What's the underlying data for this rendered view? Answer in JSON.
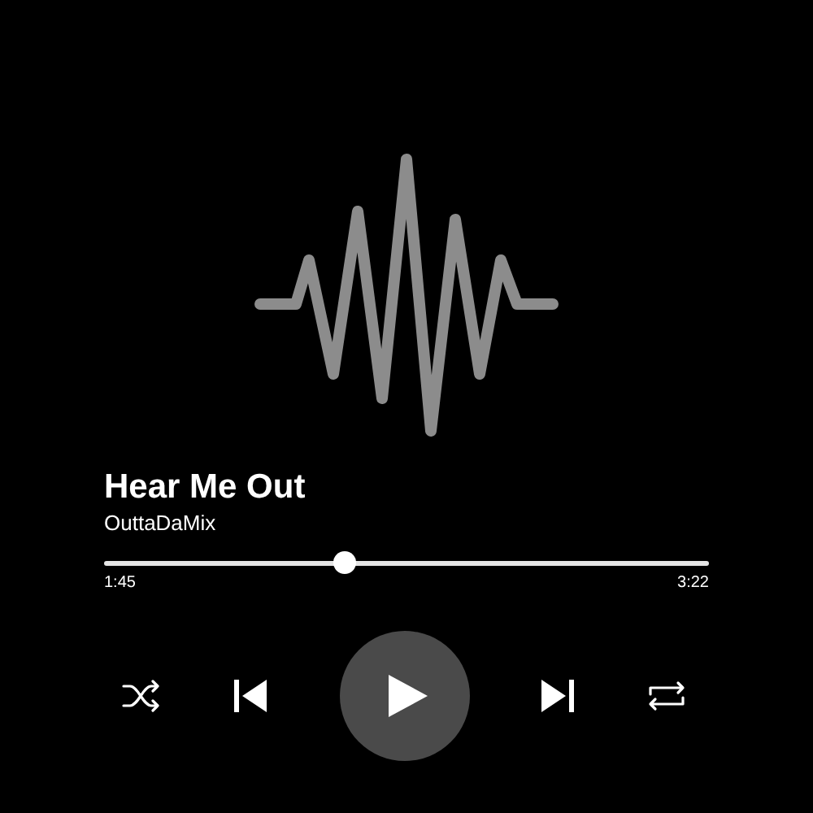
{
  "track": {
    "title": "Hear Me Out",
    "artist": "OuttaDaMix"
  },
  "progress": {
    "level": 0.395,
    "elapsed": "1:45",
    "duration": "3:22"
  },
  "controls": [
    {
      "kind": "shuffle"
    },
    {
      "kind": "previous"
    },
    {
      "kind": "play"
    },
    {
      "kind": "next"
    },
    {
      "kind": "repeat"
    }
  ]
}
